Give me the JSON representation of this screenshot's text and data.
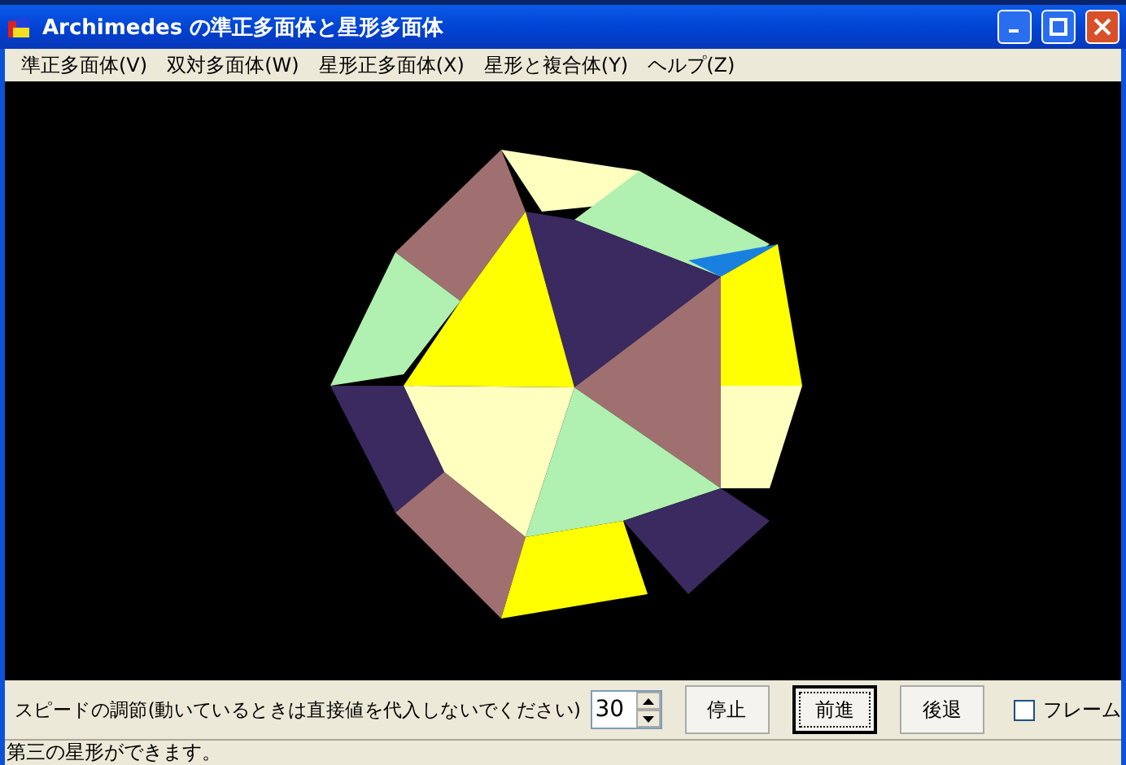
{
  "window": {
    "title": "Archimedes の準正多面体と星形多面体"
  },
  "menu": [
    "準正多面体(V)",
    "双対多面体(W)",
    "星形正多面体(X)",
    "星形と複合体(Y)",
    "ヘルプ(Z)"
  ],
  "controls": {
    "speed_label": "スピードの調節(動いているときは直接値を代入しないでください)",
    "speed": "30",
    "buttons": [
      {
        "label": "停止",
        "focused": false
      },
      {
        "label": "前進",
        "focused": true
      },
      {
        "label": "後退",
        "focused": false
      }
    ],
    "frame": {
      "label": "フレーム",
      "checked": false
    }
  },
  "status_bar": "第三の星形ができます。"
}
